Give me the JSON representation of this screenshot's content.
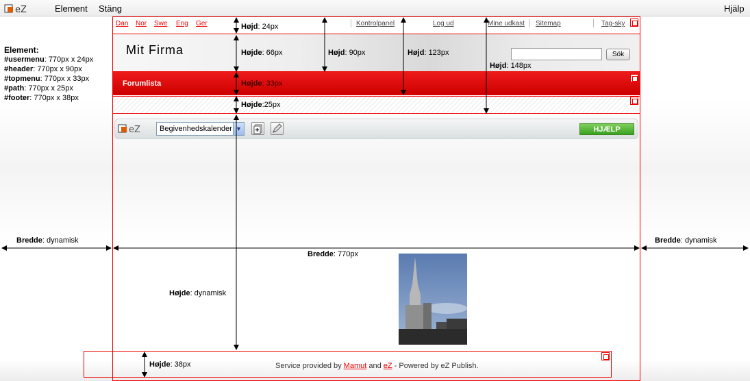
{
  "appbar": {
    "menu_element": "Element",
    "menu_close": "Stäng",
    "menu_help": "Hjälp"
  },
  "usermenu": {
    "languages": [
      "Dan",
      "Nor",
      "Swe",
      "Eng",
      "Ger"
    ],
    "control_panel": "Kontrolpanel",
    "logout": "Log ud",
    "my_drafts": "Mine udkast",
    "sitemap": "Sitemap",
    "tag_cloud": "Tag-sky"
  },
  "header": {
    "site_title": "Mit  Firma",
    "search_button": "Sök",
    "search_value": ""
  },
  "topmenu": {
    "item": "Forumlista"
  },
  "toolbar": {
    "select_value": "Begivenhedskalender",
    "help_button": "HJÆLP"
  },
  "footer": {
    "prefix": "Service provided by ",
    "link1": "Mamut",
    "mid": " and ",
    "link2": "eZ",
    "suffix": " - Powered by eZ Publish."
  },
  "legend": {
    "title": "Element:",
    "rows": [
      {
        "key": "#usermenu",
        "value": ": 770px x 24px"
      },
      {
        "key": "#header",
        "value": ": 770px x 90px"
      },
      {
        "key": "#topmenu",
        "value": ": 770px x 33px"
      },
      {
        "key": "#path",
        "value": ": 770px x 25px"
      },
      {
        "key": "#footer",
        "value": ": 770px x 38px"
      }
    ]
  },
  "annotations": {
    "h24": {
      "k": "Højd",
      "v": ": 24px"
    },
    "h66": {
      "k": "Højde",
      "v": ": 66px"
    },
    "h90": {
      "k": "Højd",
      "v": ": 90px"
    },
    "h123": {
      "k": "Højd",
      "v": ": 123px"
    },
    "h148": {
      "k": "Højd",
      "v": ": 148px"
    },
    "h33": {
      "k": "Højde",
      "v": ": 33px"
    },
    "h25": {
      "k": "Højde",
      "v": ":25px"
    },
    "hdyn": {
      "k": "Højde",
      "v": ": dynamisk"
    },
    "h38": {
      "k": "Højde",
      "v": ": 38px"
    },
    "bleft": {
      "k": "Bredde",
      "v": ": dynamisk"
    },
    "bright": {
      "k": "Bredde",
      "v": ": dynamisk"
    },
    "b770": {
      "k": "Bredde",
      "v": ": 770px"
    }
  },
  "colors": {
    "accent_red": "#e00000",
    "help_green": "#4caf2a"
  }
}
